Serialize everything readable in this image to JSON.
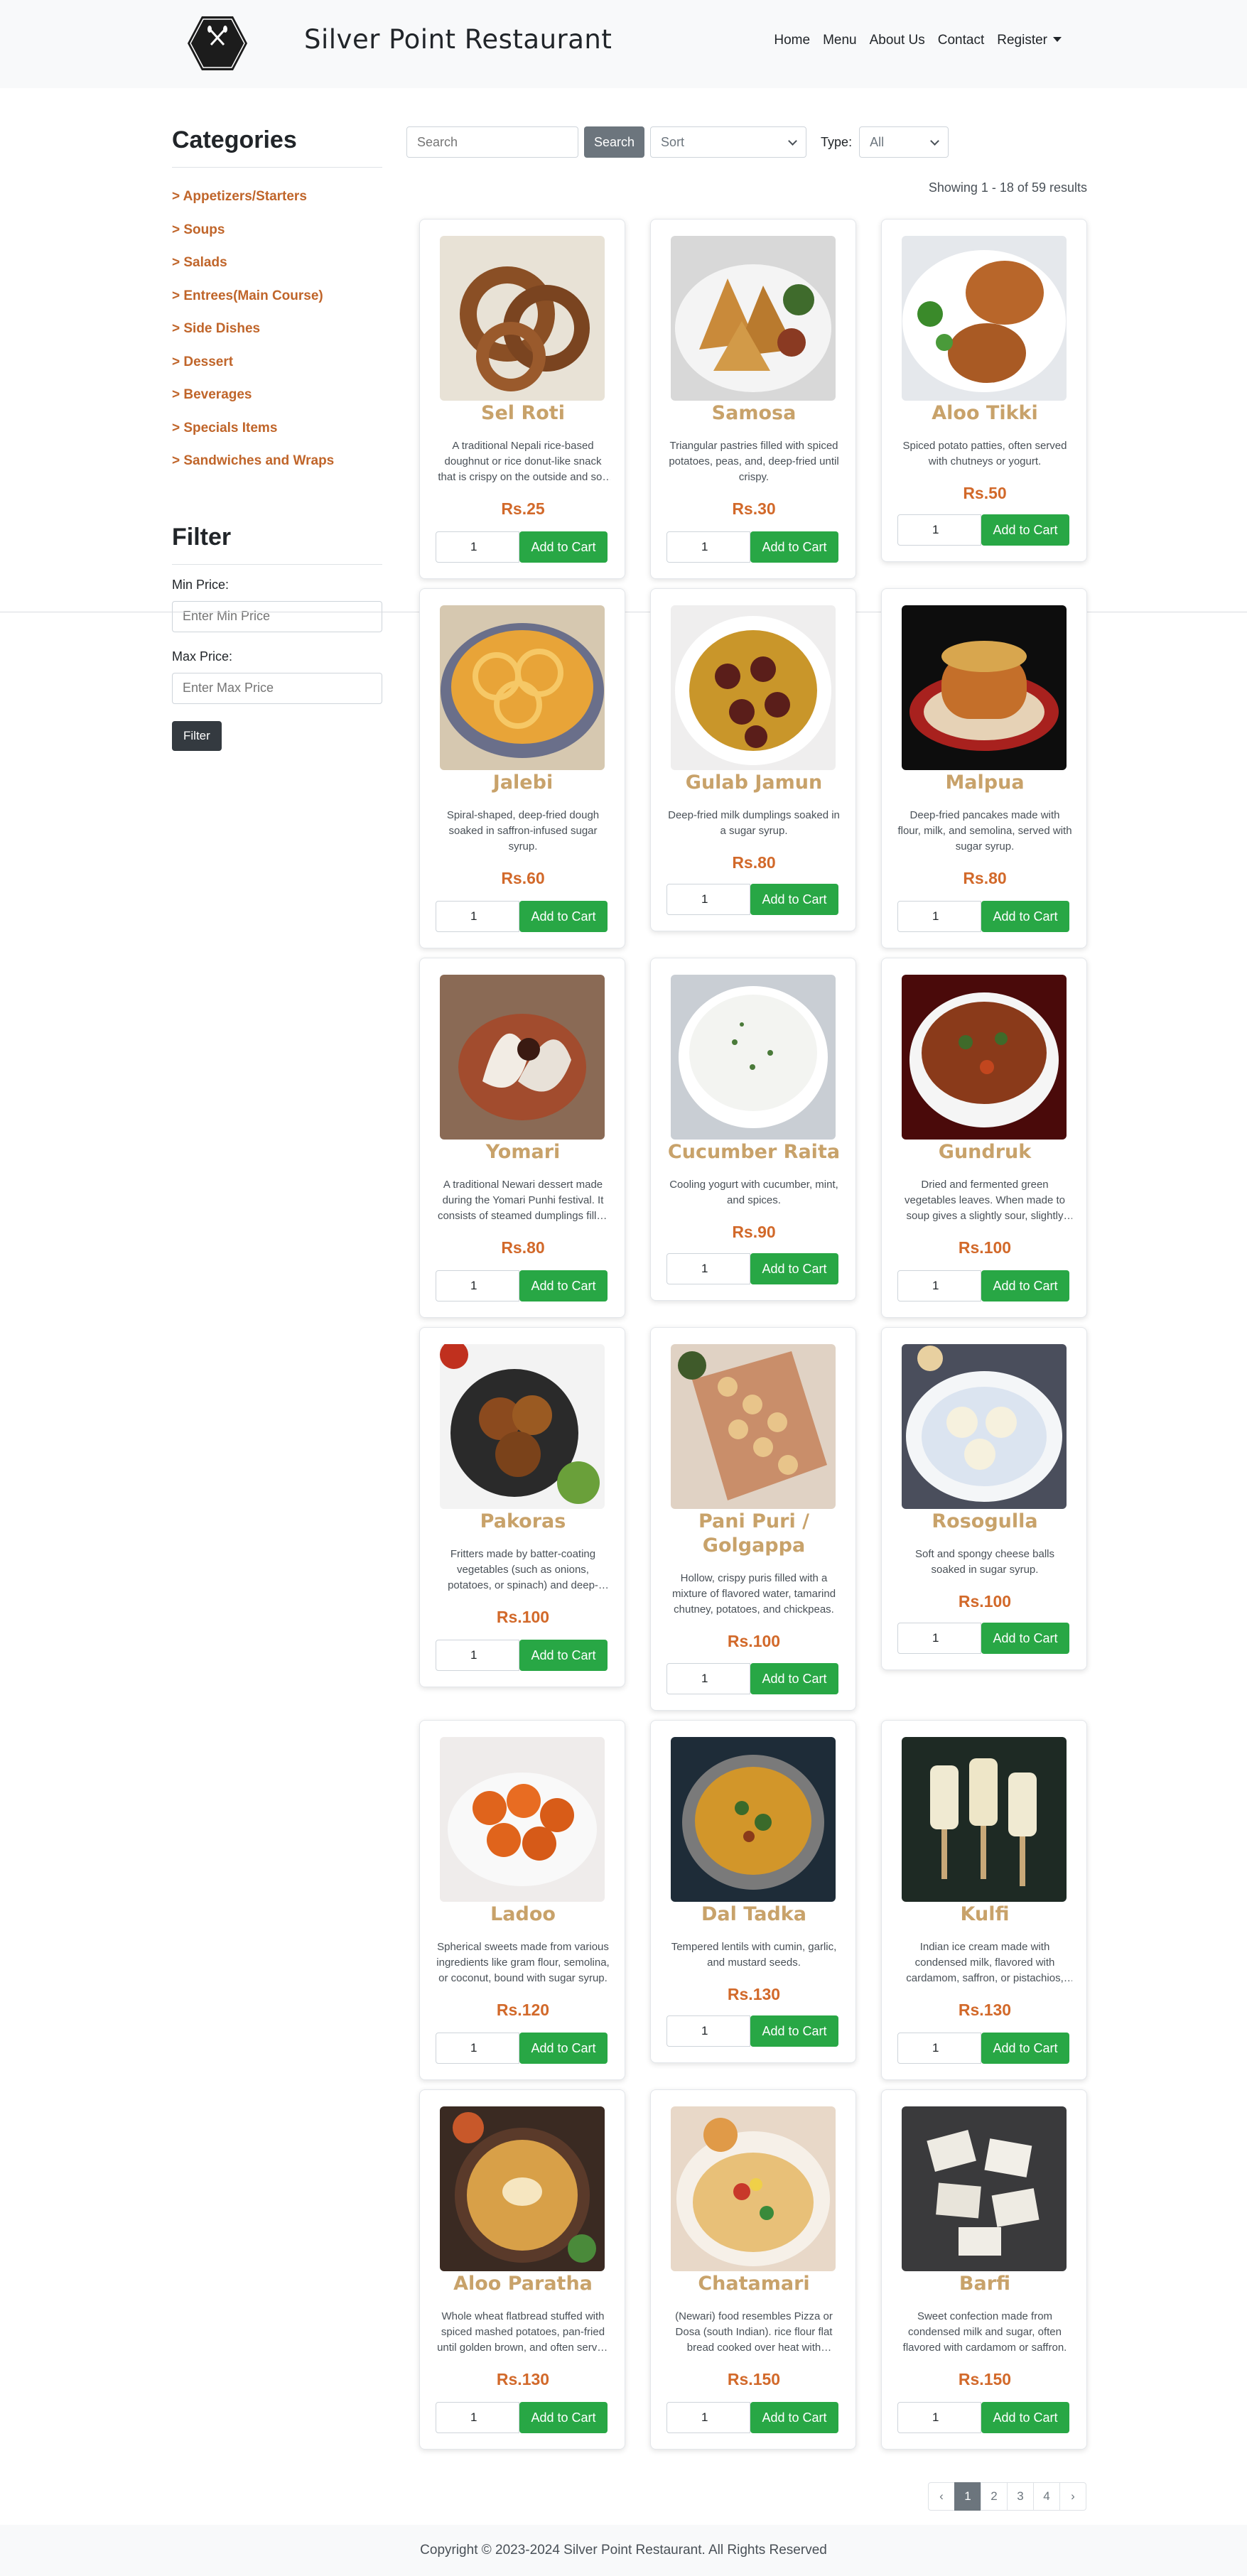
{
  "navbar": {
    "logo_text": "Silver Point Restaurant",
    "brand": "Silver Point Restaurant",
    "links": [
      "Home",
      "Menu",
      "About Us",
      "Contact"
    ],
    "register": "Register"
  },
  "sidebar": {
    "categories_heading": "Categories",
    "categories": [
      "> Appetizers/Starters",
      "> Soups",
      "> Salads",
      "> Entrees(Main Course)",
      "> Side Dishes",
      "> Dessert",
      "> Beverages",
      "> Specials Items",
      "> Sandwiches and Wraps"
    ],
    "filter_heading": "Filter",
    "min_label": "Min Price:",
    "min_placeholder": "Enter Min Price",
    "max_label": "Max Price:",
    "max_placeholder": "Enter Max Price",
    "filter_button": "Filter"
  },
  "toolbar": {
    "search_placeholder": "Search",
    "search_button": "Search",
    "sort_value": "Sort",
    "type_label": "Type:",
    "type_value": "All"
  },
  "results_text": "Showing 1 - 18 of 59 results",
  "products": [
    {
      "name": "Sel Roti",
      "desc": "A traditional Nepali rice-based doughnut or rice donut-like snack that is crispy on the outside and soft inside.",
      "price": "Rs.25",
      "qty": "1",
      "image": "sel-roti"
    },
    {
      "name": "Samosa",
      "desc": "Triangular pastries filled with spiced potatoes, peas, and, deep-fried until crispy.",
      "price": "Rs.30",
      "qty": "1",
      "image": "samosa"
    },
    {
      "name": "Aloo Tikki",
      "desc": "Spiced potato patties, often served with chutneys or yogurt.",
      "price": "Rs.50",
      "qty": "1",
      "image": "aloo-tikki"
    },
    {
      "name": "Jalebi",
      "desc": "Spiral-shaped, deep-fried dough soaked in saffron-infused sugar syrup.",
      "price": "Rs.60",
      "qty": "1",
      "image": "jalebi"
    },
    {
      "name": "Gulab Jamun",
      "desc": "Deep-fried milk dumplings soaked in a sugar syrup.",
      "price": "Rs.80",
      "qty": "1",
      "image": "gulab-jamun"
    },
    {
      "name": "Malpua",
      "desc": "Deep-fried pancakes made with flour, milk, and semolina, served with sugar syrup.",
      "price": "Rs.80",
      "qty": "1",
      "image": "malpua"
    },
    {
      "name": "Yomari",
      "desc": "A traditional Newari dessert made during the Yomari Punhi festival. It consists of steamed dumplings filled with sweet fillings.",
      "price": "Rs.80",
      "qty": "1",
      "image": "yomari"
    },
    {
      "name": "Cucumber Raita",
      "desc": "Cooling yogurt with cucumber, mint, and spices.",
      "price": "Rs.90",
      "qty": "1",
      "image": "cucumber-raita"
    },
    {
      "name": "Gundruk",
      "desc": "Dried and fermented green vegetables leaves. When made to soup gives a slightly sour, slightly bitter taste.",
      "price": "Rs.100",
      "qty": "1",
      "image": "gundruk"
    },
    {
      "name": "Pakoras",
      "desc": "Fritters made by batter-coating vegetables (such as onions, potatoes, or spinach) and deep-frying them.",
      "price": "Rs.100",
      "qty": "1",
      "image": "pakoras"
    },
    {
      "name": "Pani Puri / Golgappa",
      "desc": "Hollow, crispy puris filled with a mixture of flavored water, tamarind chutney, potatoes, and chickpeas.",
      "price": "Rs.100",
      "qty": "1",
      "image": "pani-puri"
    },
    {
      "name": "Rosogulla",
      "desc": "Soft and spongy cheese balls soaked in sugar syrup.",
      "price": "Rs.100",
      "qty": "1",
      "image": "rosogulla"
    },
    {
      "name": "Ladoo",
      "desc": "Spherical sweets made from various ingredients like gram flour, semolina, or coconut, bound with sugar syrup.",
      "price": "Rs.120",
      "qty": "1",
      "image": "ladoo"
    },
    {
      "name": "Dal Tadka",
      "desc": "Tempered lentils with cumin, garlic, and mustard seeds.",
      "price": "Rs.130",
      "qty": "1",
      "image": "dal-tadka"
    },
    {
      "name": "Kulfi",
      "desc": "Indian ice cream made with condensed milk, flavored with cardamom, saffron, or pistachios, and frozen.",
      "price": "Rs.130",
      "qty": "1",
      "image": "kulfi"
    },
    {
      "name": "Aloo Paratha",
      "desc": "Whole wheat flatbread stuffed with spiced mashed potatoes, pan-fried until golden brown, and often served with curd.",
      "price": "Rs.130",
      "qty": "1",
      "image": "aloo-paratha"
    },
    {
      "name": "Chatamari",
      "desc": "(Newari) food resembles Pizza or Dosa (south Indian). rice flour flat bread cooked over heat with toppings.",
      "price": "Rs.150",
      "qty": "1",
      "image": "chatamari"
    },
    {
      "name": "Barfi",
      "desc": "Sweet confection made from condensed milk and sugar, often flavored with cardamom or saffron.",
      "price": "Rs.150",
      "qty": "1",
      "image": "barfi"
    }
  ],
  "add_to_cart_label": "Add to Cart",
  "pagination": [
    "‹",
    "1",
    "2",
    "3",
    "4",
    "›"
  ],
  "pagination_active": "1",
  "footer": "Copyright © 2023-2024 Silver Point Restaurant. All Rights Reserved"
}
